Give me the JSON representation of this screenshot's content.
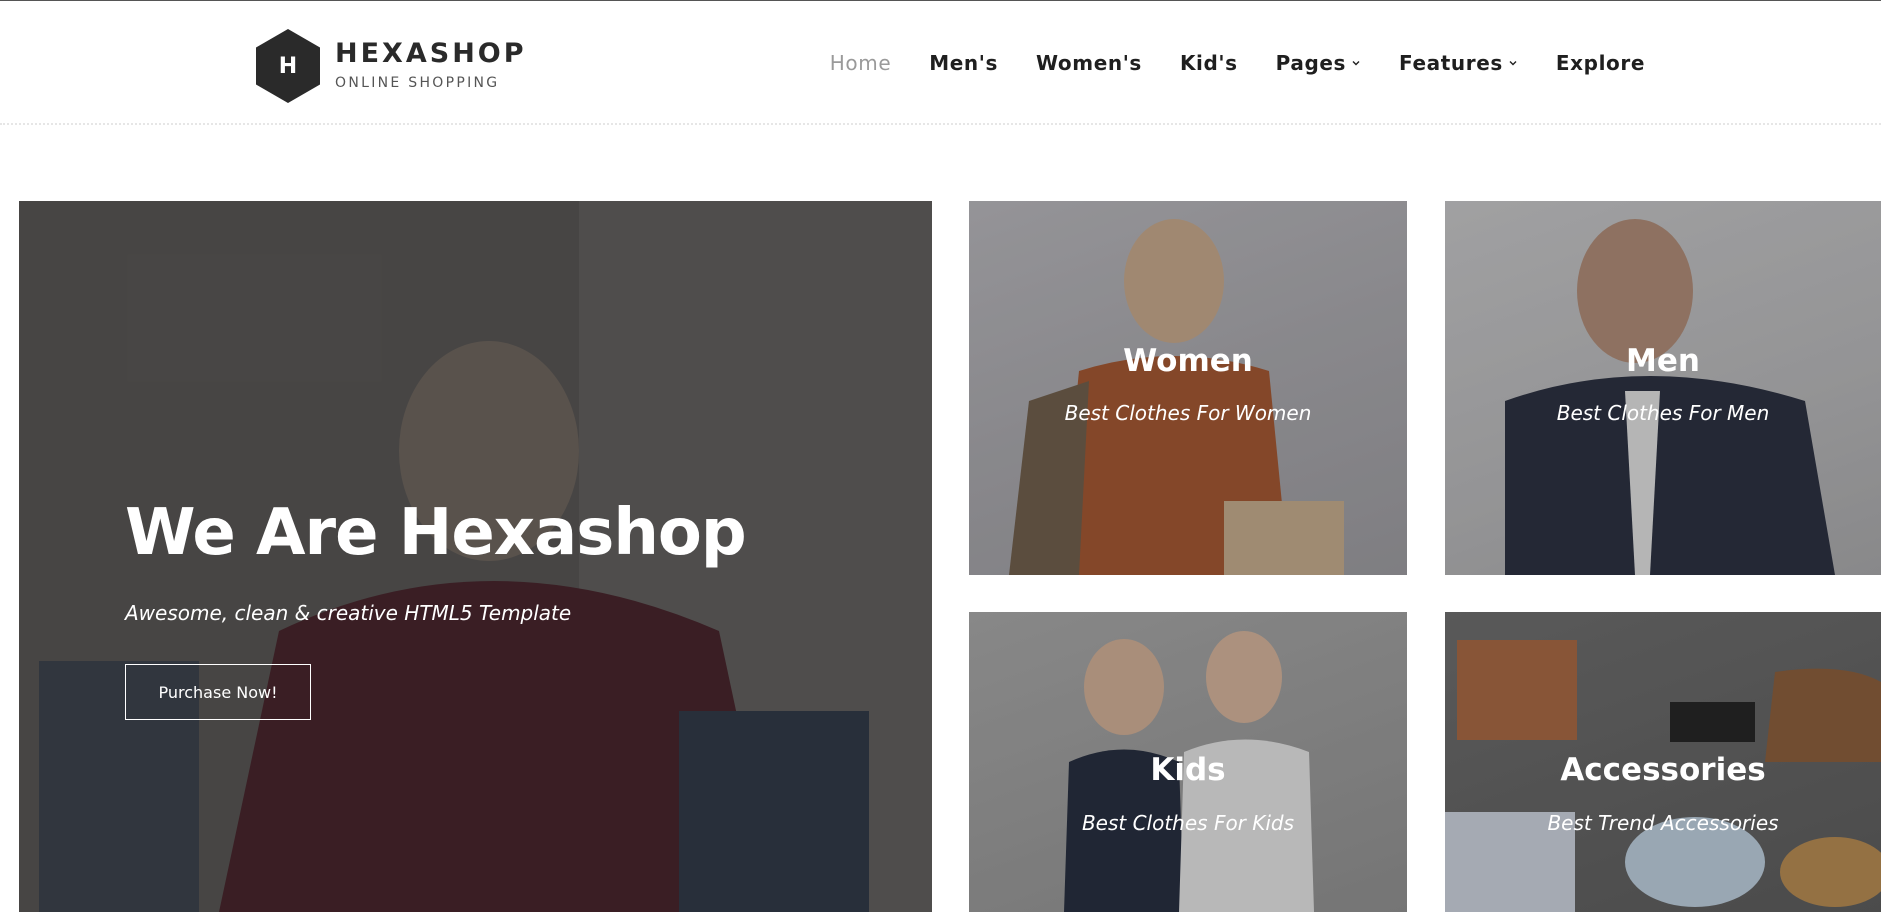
{
  "brand": {
    "logo_letter": "H",
    "title": "HEXASHOP",
    "subtitle": "ONLINE SHOPPING"
  },
  "nav": {
    "items": [
      {
        "label": "Home",
        "active": true
      },
      {
        "label": "Men's"
      },
      {
        "label": "Women's"
      },
      {
        "label": "Kid's"
      },
      {
        "label": "Pages",
        "dropdown": true
      },
      {
        "label": "Features",
        "dropdown": true
      },
      {
        "label": "Explore"
      }
    ]
  },
  "hero": {
    "title": "We Are Hexashop",
    "subtitle": "Awesome, clean & creative HTML5 Template",
    "button_label": "Purchase Now!"
  },
  "categories": [
    {
      "title": "Women",
      "subtitle": "Best Clothes For Women"
    },
    {
      "title": "Men",
      "subtitle": "Best Clothes For Men"
    },
    {
      "title": "Kids",
      "subtitle": "Best Clothes For Kids"
    },
    {
      "title": "Accessories",
      "subtitle": "Best Trend Accessories"
    }
  ],
  "colors": {
    "logo_dark": "#2a2a2a",
    "nav_active": "#9a9a9a",
    "nav_text": "#1f1f1f"
  }
}
